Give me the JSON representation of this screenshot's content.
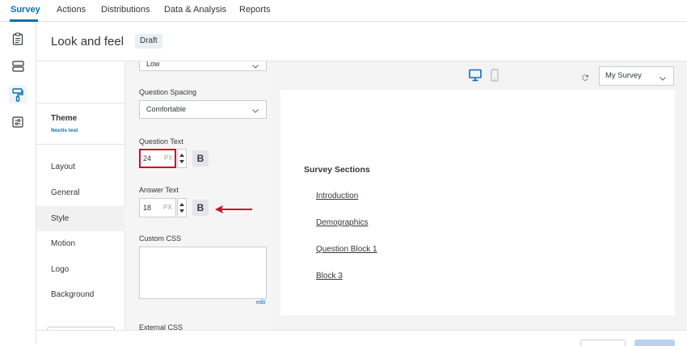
{
  "topnav": {
    "tabs": [
      "Survey",
      "Actions",
      "Distributions",
      "Data & Analysis",
      "Reports"
    ],
    "active_tab": "Survey",
    "accent": "#0b6fb2"
  },
  "leftrail": {
    "icons": [
      "clipboard-icon",
      "layout-blocks-icon",
      "paint-roller-icon",
      "sliders-icon"
    ],
    "active_icon": "paint-roller-icon"
  },
  "header": {
    "title": "Look and feel",
    "badge": "Draft"
  },
  "menu": {
    "theme_label": "Theme",
    "theme_name": "Noctis test",
    "items": [
      "Layout",
      "General",
      "Style",
      "Motion",
      "Logo",
      "Background"
    ],
    "active_item": "Style"
  },
  "panel": {
    "top_select_value": "Low",
    "question_spacing_label": "Question Spacing",
    "question_spacing_value": "Comfortable",
    "question_text_label": "Question Text",
    "question_text_size": "24",
    "answer_text_label": "Answer Text",
    "answer_text_size": "18",
    "unit": "PX",
    "bold_label": "B",
    "custom_css_label": "Custom CSS",
    "edit_label": "edit",
    "external_css_label": "External CSS"
  },
  "preview": {
    "survey_select": "My Survey",
    "heading": "Survey Sections",
    "links": [
      "Introduction",
      "Demographics",
      "Question Block 1",
      "Block 3"
    ]
  },
  "annotation": {
    "color": "#c8102e"
  }
}
